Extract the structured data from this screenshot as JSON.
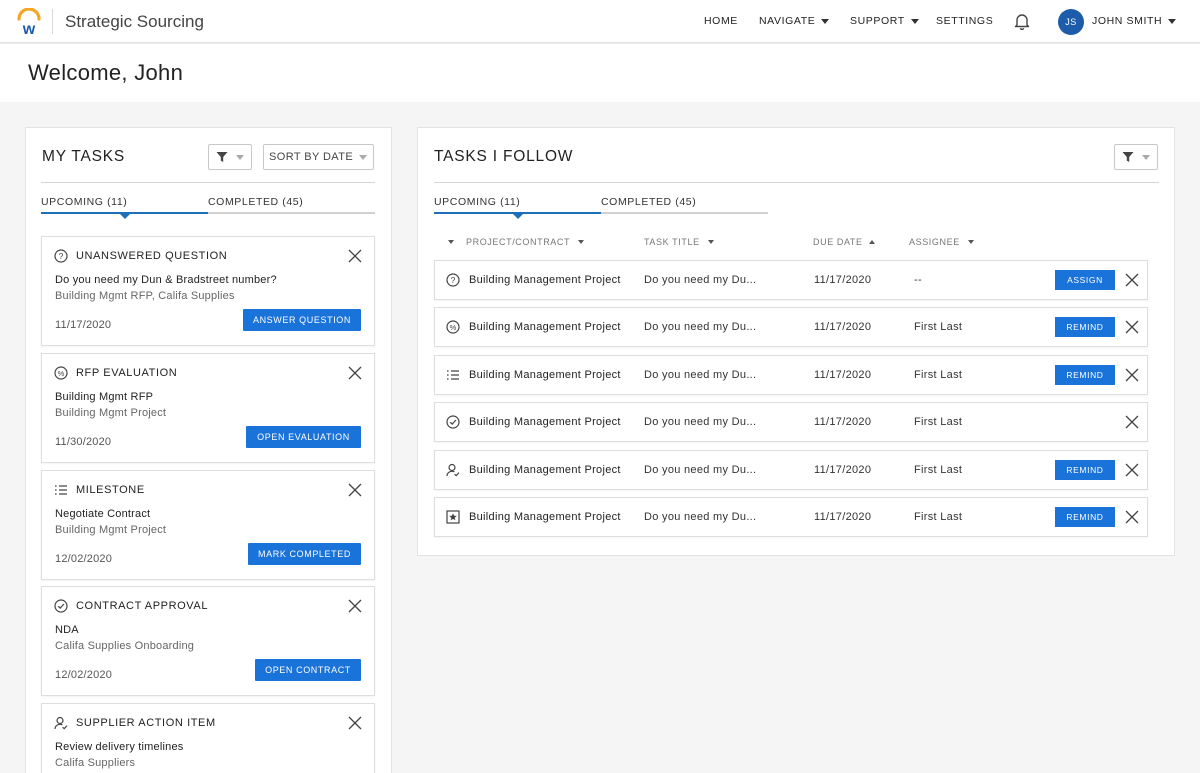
{
  "header": {
    "app_title": "Strategic Sourcing",
    "nav": [
      {
        "label": "HOME"
      },
      {
        "label": "NAVIGATE"
      },
      {
        "label": "SUPPORT"
      },
      {
        "label": "SETTINGS"
      }
    ],
    "user_initials": "JS",
    "user_name": "JOHN SMITH",
    "icons": {
      "logo": "workday-logo",
      "bell": "bell-icon"
    },
    "colors": {
      "accent": "#1a73d9",
      "avatar": "#1d5cab",
      "logo_orange": "#f5a623",
      "logo_blue": "#1d5cab"
    }
  },
  "welcome": "Welcome, John",
  "my_tasks": {
    "title": "MY TASKS",
    "sort_label": "SORT BY DATE",
    "tabs": [
      {
        "label": "UPCOMING (11)",
        "active": true
      },
      {
        "label": "COMPLETED (45)",
        "active": false
      }
    ],
    "cards": [
      {
        "icon": "question-circle-icon",
        "type": "UNANSWERED QUESTION",
        "line1": "Do you need my Dun & Bradstreet number?",
        "line2": "Building Mgmt RFP, Califa Supplies",
        "date": "11/17/2020",
        "action": "ANSWER QUESTION"
      },
      {
        "icon": "percent-circle-icon",
        "type": "RFP EVALUATION",
        "line1": "Building Mgmt RFP",
        "line2": "Building Mgmt Project",
        "date": "11/30/2020",
        "action": "OPEN EVALUATION"
      },
      {
        "icon": "list-icon",
        "type": "MILESTONE",
        "line1": "Negotiate Contract",
        "line2": "Building Mgmt Project",
        "date": "12/02/2020",
        "action": "MARK COMPLETED"
      },
      {
        "icon": "check-circle-icon",
        "type": "CONTRACT APPROVAL",
        "line1": "NDA",
        "line2": "Califa Supplies Onboarding",
        "date": "12/02/2020",
        "action": "OPEN CONTRACT"
      },
      {
        "icon": "user-check-icon",
        "type": "SUPPLIER ACTION ITEM",
        "line1": "Review delivery timelines",
        "line2": "Califa Suppliers",
        "date": "",
        "action": ""
      }
    ]
  },
  "tasks_follow": {
    "title": "TASKS I FOLLOW",
    "tabs": [
      {
        "label": "UPCOMING (11)",
        "active": true
      },
      {
        "label": "COMPLETED (45)",
        "active": false
      }
    ],
    "columns": [
      "PROJECT/CONTRACT",
      "TASK TITLE",
      "DUE DATE",
      "ASSIGNEE"
    ],
    "rows": [
      {
        "icon": "question-circle-icon",
        "project": "Building Management Project",
        "task": "Do you need my Du...",
        "due": "11/17/2020",
        "assignee": "--",
        "action": "ASSIGN"
      },
      {
        "icon": "percent-circle-icon",
        "project": "Building Management Project",
        "task": "Do you need my Du...",
        "due": "11/17/2020",
        "assignee": "First Last",
        "action": "REMIND"
      },
      {
        "icon": "list-icon",
        "project": "Building Management Project",
        "task": "Do you need my Du...",
        "due": "11/17/2020",
        "assignee": "First Last",
        "action": "REMIND"
      },
      {
        "icon": "check-circle-icon",
        "project": "Building Management Project",
        "task": "Do you need my Du...",
        "due": "11/17/2020",
        "assignee": "First Last",
        "action": ""
      },
      {
        "icon": "user-check-icon",
        "project": "Building Management Project",
        "task": "Do you need my Du...",
        "due": "11/17/2020",
        "assignee": "First Last",
        "action": "REMIND"
      },
      {
        "icon": "star-box-icon",
        "project": "Building Management Project",
        "task": "Do you need my Du...",
        "due": "11/17/2020",
        "assignee": "First Last",
        "action": "REMIND"
      }
    ]
  }
}
